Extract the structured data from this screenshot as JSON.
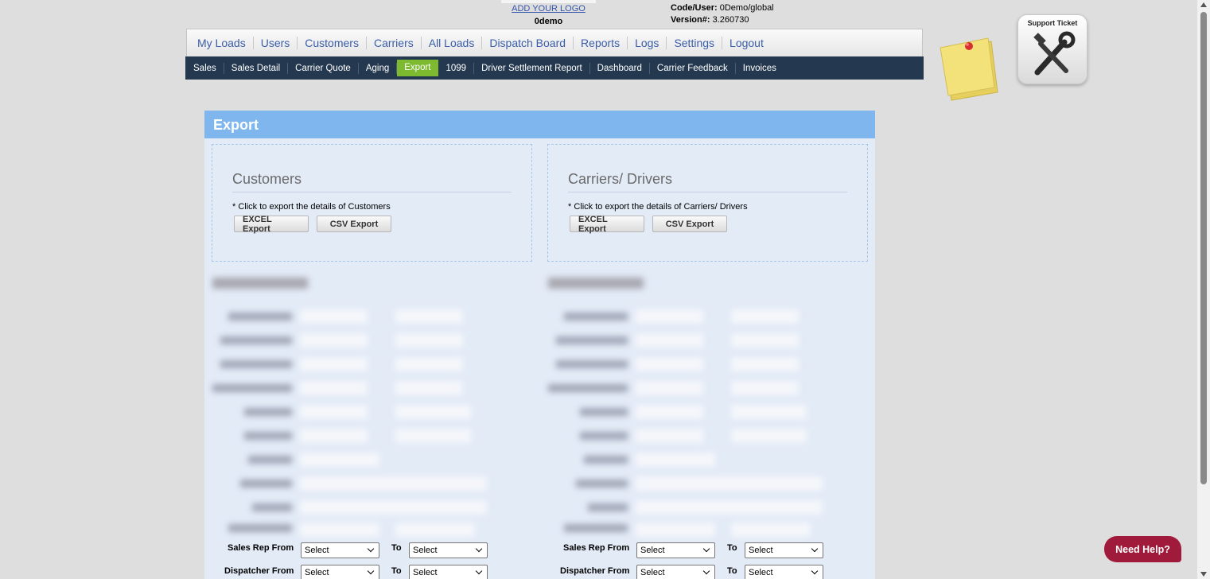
{
  "header": {
    "logo_link": "ADD YOUR LOGO",
    "company": "0demo",
    "code_user_label": "Code/User:",
    "code_user_value": "0Demo/global",
    "version_label": "Version#:",
    "version_value": "3.260730"
  },
  "main_menu": [
    "My Loads",
    "Users",
    "Customers",
    "Carriers",
    "All Loads",
    "Dispatch Board",
    "Reports",
    "Logs",
    "Settings",
    "Logout"
  ],
  "sub_menu": [
    "Sales",
    "Sales Detail",
    "Carrier Quote",
    "Aging",
    "Export",
    "1099",
    "Driver Settlement Report",
    "Dashboard",
    "Carrier Feedback",
    "Invoices"
  ],
  "sub_menu_active": "Export",
  "support_ticket": {
    "label": "Support Ticket"
  },
  "export": {
    "title": "Export",
    "customers": {
      "heading": "Customers",
      "note": "* Click to export the details of Customers",
      "excel": "EXCEL Export",
      "csv": "CSV Export"
    },
    "carriers": {
      "heading": "Carriers/ Drivers",
      "note": "* Click to export the details of Carriers/ Drivers",
      "excel": "EXCEL Export",
      "csv": "CSV Export"
    }
  },
  "filters": {
    "sales_rep_from": "Sales Rep From",
    "dispatcher_from": "Dispatcher From",
    "to": "To",
    "select": "Select"
  },
  "need_help": "Need Help?"
}
